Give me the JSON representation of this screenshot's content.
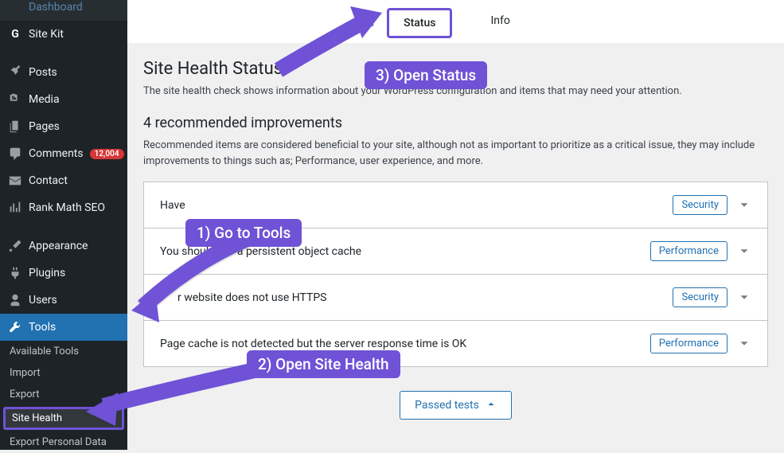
{
  "sidebar": {
    "items": [
      {
        "label": "Dashboard",
        "icon": "dashboard"
      },
      {
        "label": "Site Kit",
        "icon": "G"
      },
      {
        "label": "Posts",
        "icon": "pin"
      },
      {
        "label": "Media",
        "icon": "media"
      },
      {
        "label": "Pages",
        "icon": "page"
      },
      {
        "label": "Comments",
        "icon": "comment",
        "badge": "12,004"
      },
      {
        "label": "Contact",
        "icon": "mail"
      },
      {
        "label": "Rank Math SEO",
        "icon": "chart"
      },
      {
        "label": "Appearance",
        "icon": "brush"
      },
      {
        "label": "Plugins",
        "icon": "plug"
      },
      {
        "label": "Users",
        "icon": "user"
      },
      {
        "label": "Tools",
        "icon": "wrench",
        "active": true
      }
    ],
    "sub_items": [
      "Available Tools",
      "Import",
      "Export",
      "Site Health",
      "Export Personal Data"
    ]
  },
  "tabs": {
    "status": "Status",
    "info": "Info"
  },
  "page": {
    "title": "Site Health Status",
    "description": "The site health check shows information about your WordPress configuration and items that may need your attention.",
    "section_title": "4 recommended improvements",
    "section_desc": "Recommended items are considered beneficial to your site, although not as important to prioritize as a critical issue, they may include improvements to things such as; Performance, user experience, and more.",
    "rows": [
      {
        "title": "Have",
        "tag": "Security"
      },
      {
        "title": "You should        a persistent object cache",
        "tag": "Performance"
      },
      {
        "title": "r website does not use HTTPS",
        "tag": "Security"
      },
      {
        "title": "Page cache is not detected but the server response time is OK",
        "tag": "Performance"
      }
    ],
    "passed_label": "Passed tests"
  },
  "annotations": {
    "step1": "1) Go to Tools",
    "step2": "2) Open Site Health",
    "step3": "3) Open Status"
  }
}
